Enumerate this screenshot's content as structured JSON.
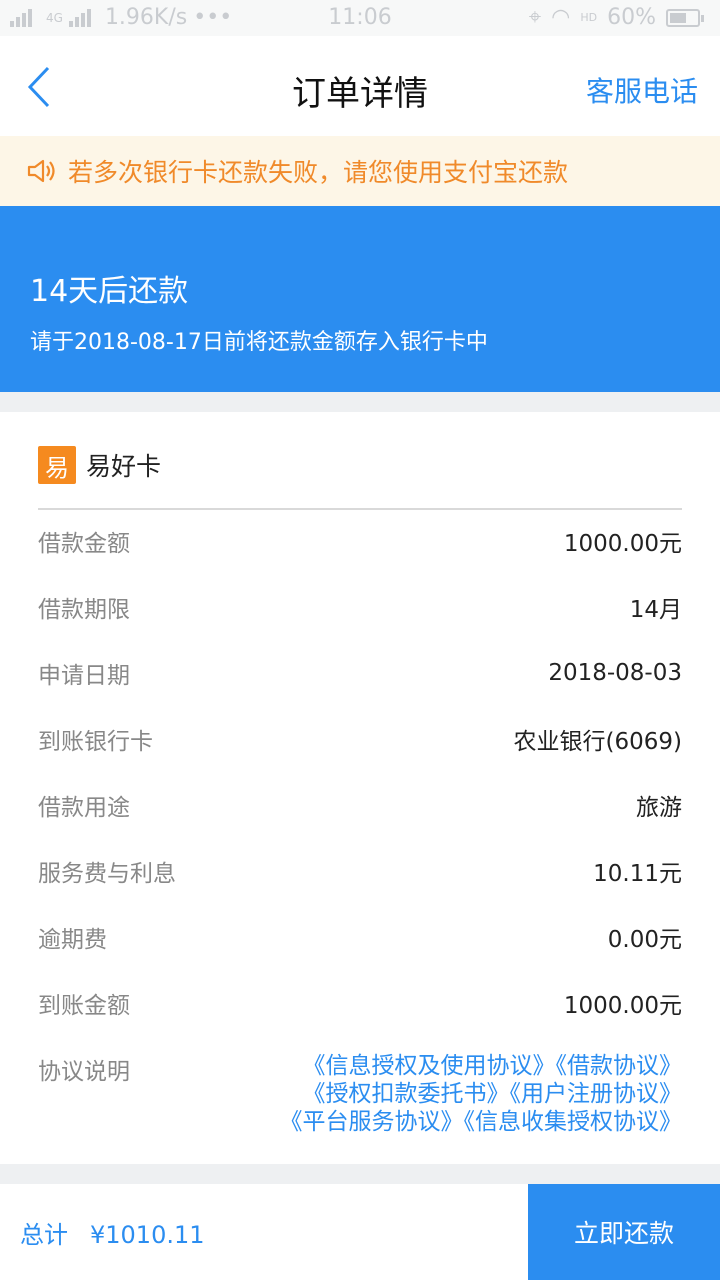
{
  "status_bar": {
    "signal_text": "4G",
    "network_speed": "1.96K/s",
    "dots": "•••",
    "time": "11:06",
    "hd_label": "HD",
    "battery_percent": "60%",
    "battery_level": 0.6
  },
  "nav": {
    "title": "订单详情",
    "service_label": "客服电话"
  },
  "notice": {
    "text": "若多次银行卡还款失败，请您使用支付宝还款"
  },
  "banner": {
    "title": "14天后还款",
    "subtitle": "请于2018-08-17日前将还款金额存入银行卡中"
  },
  "brand": {
    "logo_char": "易",
    "name": "易好卡"
  },
  "details": [
    {
      "label": "借款金额",
      "value": "1000.00元"
    },
    {
      "label": "借款期限",
      "value": "14月"
    },
    {
      "label": "申请日期",
      "value": "2018-08-03"
    },
    {
      "label": "到账银行卡",
      "value": "农业银行(6069)"
    },
    {
      "label": "借款用途",
      "value": "旅游"
    },
    {
      "label": "服务费与利息",
      "value": "10.11元"
    },
    {
      "label": "逾期费",
      "value": "0.00元"
    },
    {
      "label": "到账金额",
      "value": "1000.00元"
    }
  ],
  "agreement": {
    "label": "协议说明",
    "links": [
      "《信息授权及使用协议》",
      "《借款协议》",
      "《授权扣款委托书》",
      "《用户注册协议》",
      "《平台服务协议》",
      "《信息收集授权协议》"
    ]
  },
  "footer": {
    "total_label": "总计",
    "total_amount": "¥1010.11",
    "pay_button": "立即还款"
  },
  "colors": {
    "accent": "#2b8df0",
    "notice_text": "#f08a2a",
    "notice_bg": "#fdf6e7",
    "brand_orange": "#f58a1f"
  }
}
